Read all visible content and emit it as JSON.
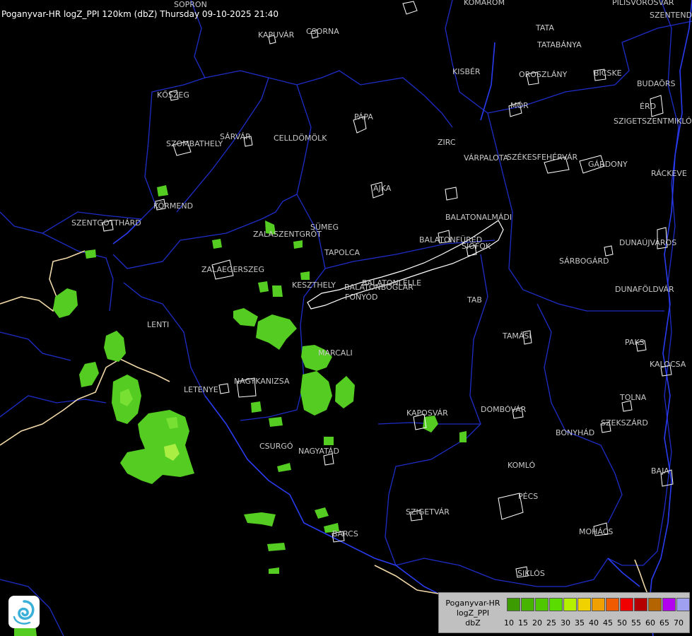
{
  "header": {
    "title": "Poganyvar-HR logZ_PPI 120km (dbZ) Thursday 09-10-2025 21:40"
  },
  "cities": [
    "SOPRON",
    "KAPUVÁR",
    "CSORNA",
    "KOMÁROM",
    "TATA",
    "TATABÁNYA",
    "KISBÉR",
    "OROSZLÁNY",
    "PILISVÖRÖSVÁR",
    "BICSKE",
    "BUDAÖRS",
    "ÉRD",
    "SZIGETSZENTMIKLÓS",
    "SZENTENDRE",
    "RÁCKEVE",
    "KŐSZEG",
    "SZOMBATHELY",
    "SÁRVÁR",
    "CELLDÖMÖLK",
    "PÁPA",
    "ZIRC",
    "MÓR",
    "VÁRPALOTA",
    "SZÉKESFEHÉRVÁR",
    "GÁRDONY",
    "AJKA",
    "KÖRMEND",
    "SZENTGOTTHÁRD",
    "ZALASZENTGRÓT",
    "SÜMEG",
    "TAPOLCA",
    "BALATONALMÁDI",
    "BALATONFÜRED",
    "SIÓFOK",
    "ZALAEGERSZEG",
    "KESZTHELY",
    "BALATONLELLE",
    "BALATONBOGLÁR",
    "FONYÓD",
    "TAB",
    "DUNAÚJVÁROS",
    "SÁRBOGÁRD",
    "DUNAFÖLDVÁR",
    "LENTI",
    "TAMÁSI",
    "MARCALI",
    "PAKS",
    "KALOCSA",
    "LETENYE",
    "NAGYKANIZSA",
    "TOLNA",
    "KAPOSVÁR",
    "DOMBÓVÁR",
    "SZEKSZÁRD",
    "BONYHÁD",
    "CSURGÓ",
    "NAGYATÁD",
    "KOMLÓ",
    "BAJA",
    "SZIGETVÁR",
    "PÉCS",
    "BARCS",
    "MOHÁCS",
    "SIKLÓS"
  ],
  "legend": {
    "title_line1": "Poganyvar-HR",
    "title_line2": "logZ_PPI",
    "title_line3": "dbZ",
    "ticks": [
      "10",
      "15",
      "20",
      "25",
      "30",
      "35",
      "40",
      "45",
      "50",
      "55",
      "60",
      "65",
      "70"
    ],
    "colors": [
      "#3c9b00",
      "#46b400",
      "#50c800",
      "#5adc00",
      "#b4f000",
      "#f0d200",
      "#f0a000",
      "#f05a00",
      "#f00000",
      "#b40000",
      "#b46400",
      "#b400f0",
      "#a0a0f0"
    ]
  },
  "colors": {
    "background": "#000000",
    "river": "#2233dd",
    "border": "#f0d8a8",
    "county": "#1e2dc8",
    "echo_light": "#55cc22",
    "echo_mid": "#66dd33",
    "echo_core": "#aaee44"
  }
}
